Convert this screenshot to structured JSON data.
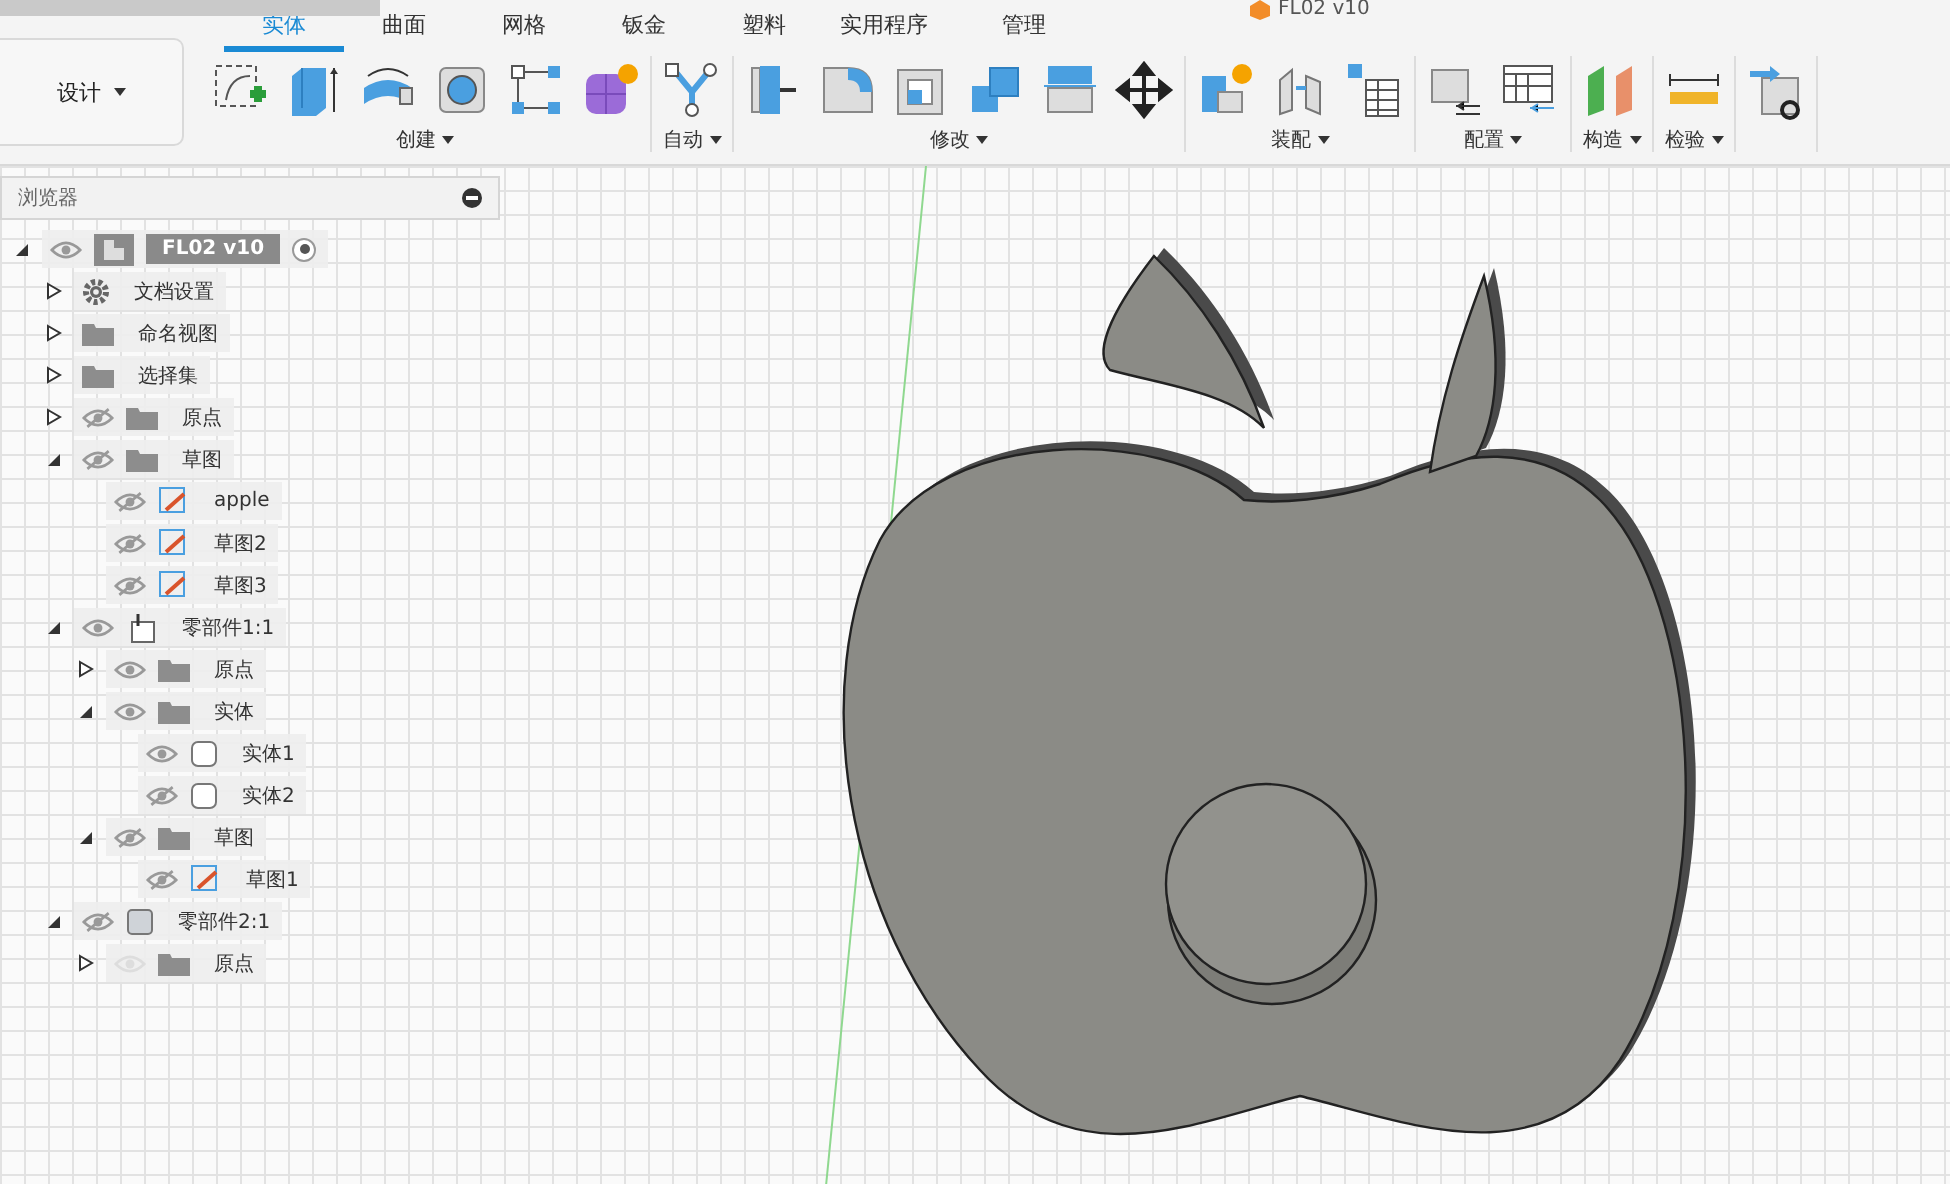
{
  "window": {
    "title": "FL02 v10"
  },
  "workspace_button": {
    "label": "设计"
  },
  "tabs": [
    {
      "label": "实体",
      "selected": true
    },
    {
      "label": "曲面",
      "selected": false
    },
    {
      "label": "网格",
      "selected": false
    },
    {
      "label": "钣金",
      "selected": false
    },
    {
      "label": "塑料",
      "selected": false
    },
    {
      "label": "实用程序",
      "selected": false
    },
    {
      "label": "管理",
      "selected": false
    }
  ],
  "tool_groups": [
    {
      "label": "创建"
    },
    {
      "label": "自动"
    },
    {
      "label": "修改"
    },
    {
      "label": "装配"
    },
    {
      "label": "配置"
    },
    {
      "label": "构造"
    },
    {
      "label": "检验"
    }
  ],
  "browser": {
    "title": "浏览器",
    "tree": [
      {
        "label": "FL02 v10",
        "kind": "document",
        "visible": true,
        "expanded": true,
        "active": true,
        "children": [
          {
            "label": "文档设置",
            "kind": "settings",
            "expanded": false
          },
          {
            "label": "命名视图",
            "kind": "folder",
            "expanded": false
          },
          {
            "label": "选择集",
            "kind": "folder",
            "expanded": false
          },
          {
            "label": "原点",
            "kind": "folder",
            "visible": false,
            "expanded": false
          },
          {
            "label": "草图",
            "kind": "folder",
            "visible": false,
            "expanded": true,
            "children": [
              {
                "label": "apple",
                "kind": "sketch",
                "visible": false
              },
              {
                "label": "草图2",
                "kind": "sketch",
                "visible": false
              },
              {
                "label": "草图3",
                "kind": "sketch",
                "visible": false
              }
            ]
          },
          {
            "label": "零部件1:1",
            "kind": "component",
            "visible": true,
            "expanded": true,
            "children": [
              {
                "label": "原点",
                "kind": "folder",
                "visible": true,
                "expanded": false
              },
              {
                "label": "实体",
                "kind": "folder",
                "visible": true,
                "expanded": true,
                "children": [
                  {
                    "label": "实体1",
                    "kind": "body",
                    "visible": true
                  },
                  {
                    "label": "实体2",
                    "kind": "body",
                    "visible": false
                  }
                ]
              },
              {
                "label": "草图",
                "kind": "folder",
                "visible": false,
                "expanded": true,
                "children": [
                  {
                    "label": "草图1",
                    "kind": "sketch",
                    "visible": false
                  }
                ]
              }
            ]
          },
          {
            "label": "零部件2:1",
            "kind": "component2",
            "visible": false,
            "expanded": true,
            "children": [
              {
                "label": "原点",
                "kind": "folder",
                "visible": true,
                "dimmed": true,
                "expanded": false
              }
            ]
          }
        ]
      }
    ]
  }
}
